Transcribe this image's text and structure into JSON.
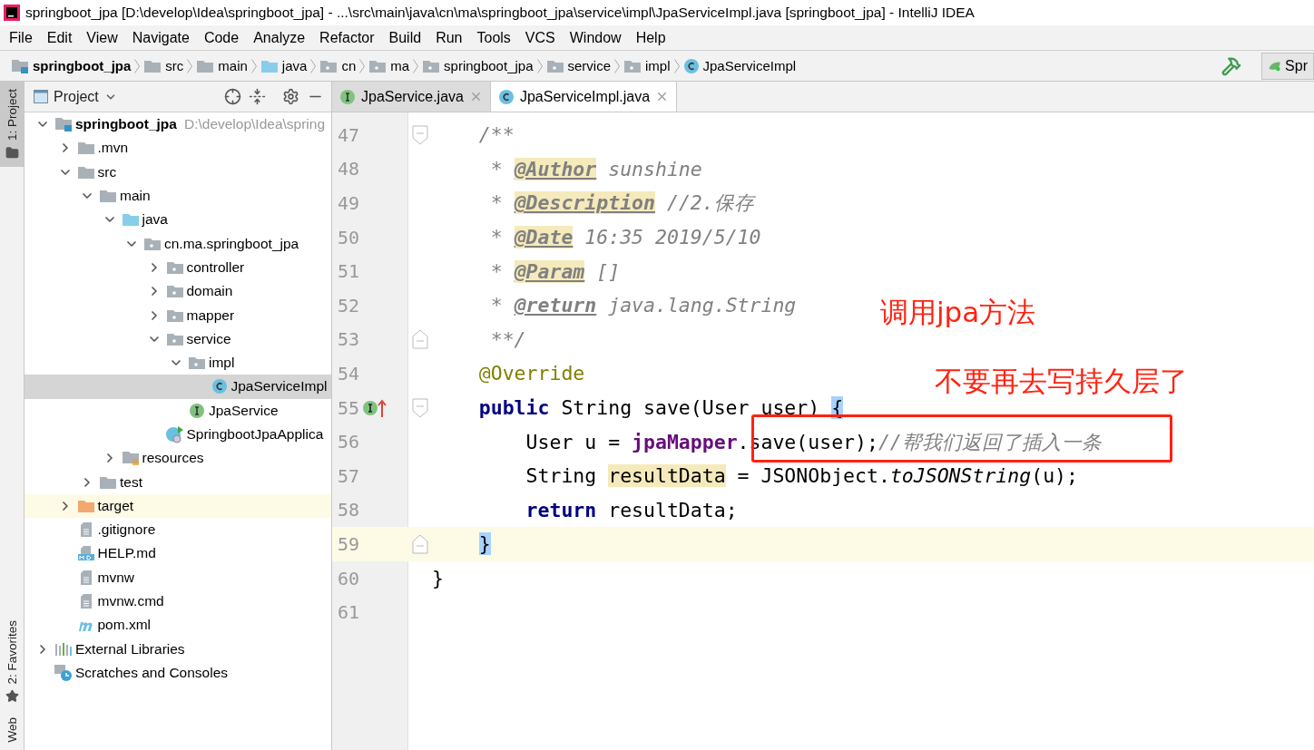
{
  "window": {
    "title": "springboot_jpa [D:\\develop\\Idea\\springboot_jpa] - ...\\src\\main\\java\\cn\\ma\\springboot_jpa\\service\\impl\\JpaServiceImpl.java [springboot_jpa] - IntelliJ IDEA"
  },
  "menu": [
    "File",
    "Edit",
    "View",
    "Navigate",
    "Code",
    "Analyze",
    "Refactor",
    "Build",
    "Run",
    "Tools",
    "VCS",
    "Window",
    "Help"
  ],
  "breadcrumb": [
    {
      "label": "springboot_jpa",
      "kind": "module"
    },
    {
      "label": "src",
      "kind": "folder"
    },
    {
      "label": "main",
      "kind": "folder"
    },
    {
      "label": "java",
      "kind": "source"
    },
    {
      "label": "cn",
      "kind": "package"
    },
    {
      "label": "ma",
      "kind": "package"
    },
    {
      "label": "springboot_jpa",
      "kind": "package"
    },
    {
      "label": "service",
      "kind": "package"
    },
    {
      "label": "impl",
      "kind": "package"
    },
    {
      "label": "JpaServiceImpl",
      "kind": "class"
    }
  ],
  "run_config": "Spr",
  "tool_strip": [
    {
      "label": "1: Project",
      "selected": true,
      "kind": "folder"
    },
    {
      "label": "2: Favorites",
      "selected": false,
      "kind": "star"
    },
    {
      "label": "Web",
      "selected": false,
      "kind": "plain"
    }
  ],
  "project": {
    "title": "Project",
    "tree": [
      {
        "label": "springboot_jpa",
        "hint": "D:\\develop\\Idea\\spring",
        "kind": "module",
        "expanded": true,
        "selected": false,
        "children": [
          {
            "label": ".mvn",
            "kind": "folder",
            "expanded": false,
            "selected": false
          },
          {
            "label": "src",
            "kind": "folder",
            "expanded": true,
            "selected": false,
            "children": [
              {
                "label": "main",
                "kind": "folder",
                "expanded": true,
                "selected": false,
                "children": [
                  {
                    "label": "java",
                    "kind": "source",
                    "expanded": true,
                    "selected": false,
                    "children": [
                      {
                        "label": "cn.ma.springboot_jpa",
                        "kind": "package",
                        "expanded": true,
                        "selected": false,
                        "children": [
                          {
                            "label": "controller",
                            "kind": "package",
                            "expanded": false,
                            "selected": false
                          },
                          {
                            "label": "domain",
                            "kind": "package",
                            "expanded": false,
                            "selected": false
                          },
                          {
                            "label": "mapper",
                            "kind": "package",
                            "expanded": false,
                            "selected": false
                          },
                          {
                            "label": "service",
                            "kind": "package",
                            "expanded": true,
                            "selected": false,
                            "children": [
                              {
                                "label": "impl",
                                "kind": "package",
                                "expanded": true,
                                "selected": false,
                                "children": [
                                  {
                                    "label": "JpaServiceImpl",
                                    "kind": "class",
                                    "selected": true
                                  }
                                ]
                              },
                              {
                                "label": "JpaService",
                                "kind": "interface",
                                "selected": false
                              }
                            ]
                          },
                          {
                            "label": "SpringbootJpaApplica",
                            "kind": "app",
                            "selected": false
                          }
                        ]
                      }
                    ]
                  },
                  {
                    "label": "resources",
                    "kind": "resources",
                    "expanded": false,
                    "selected": false
                  }
                ]
              },
              {
                "label": "test",
                "kind": "folder",
                "expanded": false,
                "selected": false
              }
            ]
          },
          {
            "label": "target",
            "kind": "excluded",
            "expanded": false,
            "selected": false
          },
          {
            "label": ".gitignore",
            "kind": "file",
            "selected": false
          },
          {
            "label": "HELP.md",
            "kind": "markdown",
            "selected": false
          },
          {
            "label": "mvnw",
            "kind": "file",
            "selected": false
          },
          {
            "label": "mvnw.cmd",
            "kind": "file",
            "selected": false
          },
          {
            "label": "pom.xml",
            "kind": "maven",
            "selected": false
          }
        ]
      },
      {
        "label": "External Libraries",
        "kind": "libraries",
        "expanded": false,
        "selected": false
      },
      {
        "label": "Scratches and Consoles",
        "kind": "scratches",
        "selected": false
      }
    ]
  },
  "editor": {
    "tabs": [
      {
        "label": "JpaService.java",
        "kind": "interface",
        "selected": false
      },
      {
        "label": "JpaServiceImpl.java",
        "kind": "class",
        "selected": true
      }
    ],
    "lines": [
      {
        "number": "47",
        "kind": "fold-start",
        "current": false,
        "tokens": [
          {
            "text": "    /**",
            "kind": "comment",
            "highlight": false
          }
        ]
      },
      {
        "number": "48",
        "kind": "plain",
        "current": false,
        "tokens": [
          {
            "text": "     *",
            "kind": "comment",
            "highlight": false
          },
          {
            "text": " @Author",
            "kind": "doc-tag",
            "highlight": true
          },
          {
            "text": " sunshine",
            "kind": "comment",
            "highlight": false
          }
        ]
      },
      {
        "number": "49",
        "kind": "plain",
        "current": false,
        "tokens": [
          {
            "text": "     *",
            "kind": "comment",
            "highlight": false
          },
          {
            "text": " @Description",
            "kind": "doc-tag",
            "highlight": true
          },
          {
            "text": " //2.保存",
            "kind": "comment",
            "highlight": false
          }
        ]
      },
      {
        "number": "50",
        "kind": "plain",
        "current": false,
        "tokens": [
          {
            "text": "     *",
            "kind": "comment",
            "highlight": false
          },
          {
            "text": " @Date",
            "kind": "doc-tag",
            "highlight": true
          },
          {
            "text": " 16:35 2019/5/10",
            "kind": "comment",
            "highlight": false
          }
        ]
      },
      {
        "number": "51",
        "kind": "plain",
        "current": false,
        "tokens": [
          {
            "text": "     *",
            "kind": "comment",
            "highlight": false
          },
          {
            "text": " @Param",
            "kind": "doc-tag",
            "highlight": true
          },
          {
            "text": " []",
            "kind": "comment",
            "highlight": false
          }
        ]
      },
      {
        "number": "52",
        "kind": "plain",
        "current": false,
        "tokens": [
          {
            "text": "     *",
            "kind": "comment",
            "highlight": false
          },
          {
            "text": " @return",
            "kind": "doc-tag",
            "highlight": false
          },
          {
            "text": " java.lang.String",
            "kind": "comment",
            "highlight": false
          }
        ]
      },
      {
        "number": "53",
        "kind": "fold-end",
        "current": false,
        "tokens": [
          {
            "text": "     **/",
            "kind": "comment",
            "highlight": false
          }
        ]
      },
      {
        "number": "54",
        "kind": "plain",
        "current": false,
        "tokens": [
          {
            "text": "    @Override",
            "kind": "annotation",
            "highlight": false
          }
        ]
      },
      {
        "number": "55",
        "kind": "implements",
        "current": false,
        "tokens": [
          {
            "text": "    public",
            "kind": "keyword",
            "highlight": false
          },
          {
            "text": " String save(User user)",
            "kind": "plain",
            "highlight": false
          },
          {
            "text": " {",
            "kind": "brace",
            "highlight": true
          }
        ]
      },
      {
        "number": "56",
        "kind": "plain",
        "current": false,
        "tokens": [
          {
            "text": "        User u =",
            "kind": "plain",
            "highlight": false
          },
          {
            "text": " jpaMapper",
            "kind": "field",
            "highlight": false
          },
          {
            "text": ".save(user);",
            "kind": "plain",
            "highlight": false
          },
          {
            "text": "//帮我们返回了插入一条",
            "kind": "comment",
            "highlight": false
          }
        ]
      },
      {
        "number": "57",
        "kind": "plain",
        "current": false,
        "tokens": [
          {
            "text": "        String",
            "kind": "plain",
            "highlight": false
          },
          {
            "text": " resultData",
            "kind": "plain",
            "highlight": true
          },
          {
            "text": " = JSONObject.",
            "kind": "plain",
            "highlight": false
          },
          {
            "text": "toJSONString",
            "kind": "static",
            "highlight": false
          },
          {
            "text": "(u);",
            "kind": "plain",
            "highlight": false
          }
        ]
      },
      {
        "number": "58",
        "kind": "plain",
        "current": false,
        "tokens": [
          {
            "text": "        return",
            "kind": "keyword",
            "highlight": false
          },
          {
            "text": " resultData;",
            "kind": "plain",
            "highlight": false
          }
        ]
      },
      {
        "number": "59",
        "kind": "fold-end",
        "current": true,
        "tokens": [
          {
            "text": "    }",
            "kind": "brace",
            "highlight": true
          }
        ]
      },
      {
        "number": "60",
        "kind": "plain",
        "current": false,
        "tokens": [
          {
            "text": "}",
            "kind": "plain",
            "highlight": false
          }
        ]
      },
      {
        "number": "61",
        "kind": "plain",
        "current": false
      }
    ]
  },
  "callouts": [
    {
      "text": "调用jpa方法"
    },
    {
      "text": "不要再去写持久层了"
    }
  ]
}
